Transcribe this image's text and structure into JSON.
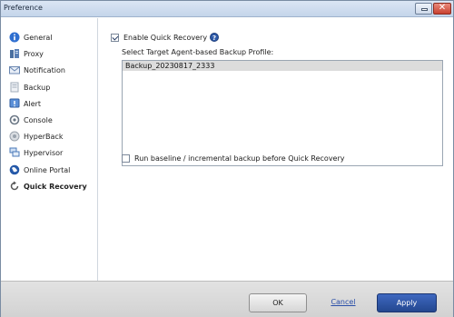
{
  "window": {
    "title": "Preference"
  },
  "sidebar": {
    "items": [
      {
        "label": "General",
        "icon": "info-icon"
      },
      {
        "label": "Proxy",
        "icon": "server-icon"
      },
      {
        "label": "Notification",
        "icon": "envelope-icon"
      },
      {
        "label": "Backup",
        "icon": "backup-icon"
      },
      {
        "label": "Alert",
        "icon": "alert-icon"
      },
      {
        "label": "Console",
        "icon": "console-icon"
      },
      {
        "label": "HyperBack",
        "icon": "hyperback-icon"
      },
      {
        "label": "Hypervisor",
        "icon": "hypervisor-icon"
      },
      {
        "label": "Online Portal",
        "icon": "globe-icon"
      },
      {
        "label": "Quick Recovery",
        "icon": "quick-recovery-icon",
        "active": true
      }
    ]
  },
  "main": {
    "enable_quick_recovery": {
      "label": "Enable Quick Recovery",
      "checked": true
    },
    "profile_label": "Select Target Agent-based Backup Profile:",
    "profiles": [
      "Backup_20230817_2333"
    ],
    "run_baseline": {
      "label": "Run baseline / incremental backup before Quick Recovery",
      "checked": false
    }
  },
  "footer": {
    "ok_label": "OK",
    "cancel_label": "Cancel",
    "apply_label": "Apply"
  },
  "colors": {
    "accent": "#2e5aa8",
    "apply_button": "#23478f",
    "titlebar": "#c4d5ea",
    "selected_row": "#dcdcdc"
  }
}
